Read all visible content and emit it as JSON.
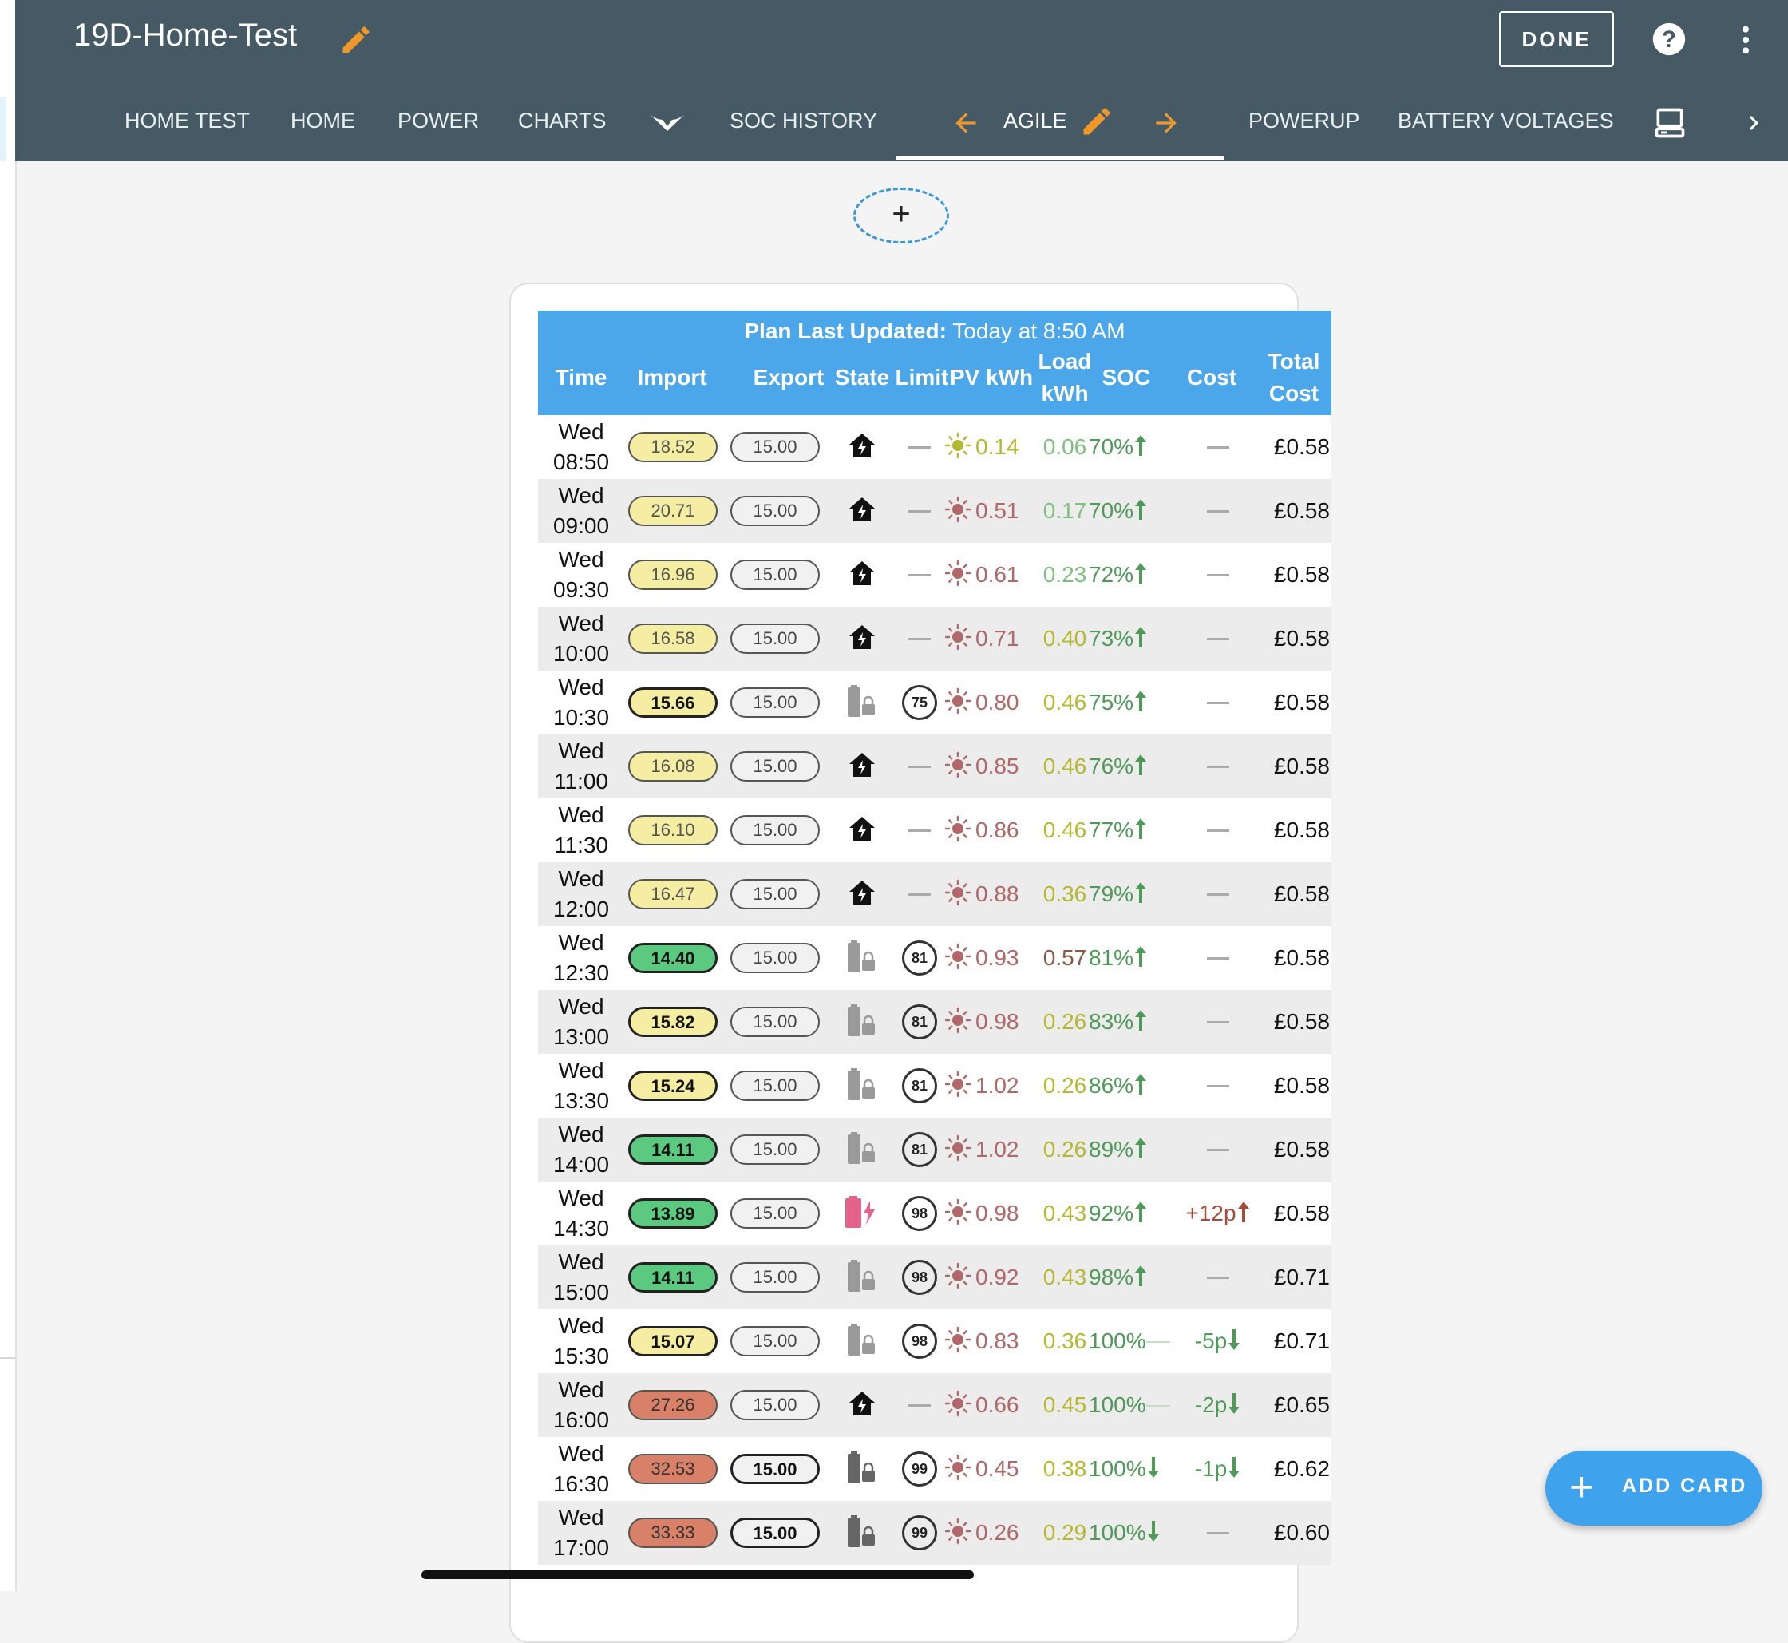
{
  "header": {
    "title": "19D-Home-Test",
    "done_label": "DONE",
    "tabs": [
      {
        "label": "HOME TEST"
      },
      {
        "label": "HOME"
      },
      {
        "label": "POWER"
      },
      {
        "label": "CHARTS"
      },
      {
        "icon": "wings-icon"
      },
      {
        "label": "SOC HISTORY"
      },
      {
        "label": "AGILE",
        "active": true
      },
      {
        "label": "POWERUP"
      },
      {
        "label": "BATTERY VOLTAGES"
      },
      {
        "icon": "computer-icon"
      }
    ]
  },
  "add_view_label": "+",
  "plan": {
    "updated_label": "Plan Last Updated:",
    "updated_value": "Today at 8:50 AM",
    "columns": {
      "time": "Time",
      "import": "Import",
      "export": "Export",
      "state": "State",
      "limit": "Limit",
      "pv": "PV kWh",
      "load_1": "Load",
      "load_2": "kWh",
      "soc": "SOC",
      "cost": "Cost",
      "total_1": "Total",
      "total_2": "Cost"
    },
    "rows": [
      {
        "day": "Wed",
        "time": "08:50",
        "import": "18.52",
        "import_style": "yellow",
        "export": "15.00",
        "export_bold": false,
        "state": "home",
        "limit": "",
        "pv": "0.14",
        "pv_color": "#b5b832",
        "sun_color": "#b5b832",
        "load": "0.06",
        "load_color": "#7fbf7f",
        "soc": "70%",
        "soc_trend": "up",
        "cost": "",
        "cost_trend": "",
        "total": "£0.58"
      },
      {
        "day": "Wed",
        "time": "09:00",
        "import": "20.71",
        "import_style": "yellow",
        "export": "15.00",
        "export_bold": false,
        "state": "home",
        "limit": "",
        "pv": "0.51",
        "pv_color": "#b06868",
        "sun_color": "#b06868",
        "load": "0.17",
        "load_color": "#7fbf7f",
        "soc": "70%",
        "soc_trend": "up",
        "cost": "",
        "cost_trend": "",
        "total": "£0.58"
      },
      {
        "day": "Wed",
        "time": "09:30",
        "import": "16.96",
        "import_style": "yellow",
        "export": "15.00",
        "export_bold": false,
        "state": "home",
        "limit": "",
        "pv": "0.61",
        "pv_color": "#b06868",
        "sun_color": "#b06868",
        "load": "0.23",
        "load_color": "#7fbf7f",
        "soc": "72%",
        "soc_trend": "up",
        "cost": "",
        "cost_trend": "",
        "total": "£0.58"
      },
      {
        "day": "Wed",
        "time": "10:00",
        "import": "16.58",
        "import_style": "yellow",
        "export": "15.00",
        "export_bold": false,
        "state": "home",
        "limit": "",
        "pv": "0.71",
        "pv_color": "#b06868",
        "sun_color": "#b06868",
        "load": "0.40",
        "load_color": "#b5b832",
        "soc": "73%",
        "soc_trend": "up",
        "cost": "",
        "cost_trend": "",
        "total": "£0.58"
      },
      {
        "day": "Wed",
        "time": "10:30",
        "import": "15.66",
        "import_style": "yellow-b",
        "export": "15.00",
        "export_bold": false,
        "state": "battery-lock",
        "limit": "75",
        "pv": "0.80",
        "pv_color": "#b06868",
        "sun_color": "#b06868",
        "load": "0.46",
        "load_color": "#b5b832",
        "soc": "75%",
        "soc_trend": "up",
        "cost": "",
        "cost_trend": "",
        "total": "£0.58"
      },
      {
        "day": "Wed",
        "time": "11:00",
        "import": "16.08",
        "import_style": "yellow",
        "export": "15.00",
        "export_bold": false,
        "state": "home",
        "limit": "",
        "pv": "0.85",
        "pv_color": "#b06868",
        "sun_color": "#b06868",
        "load": "0.46",
        "load_color": "#b5b832",
        "soc": "76%",
        "soc_trend": "up",
        "cost": "",
        "cost_trend": "",
        "total": "£0.58"
      },
      {
        "day": "Wed",
        "time": "11:30",
        "import": "16.10",
        "import_style": "yellow",
        "export": "15.00",
        "export_bold": false,
        "state": "home",
        "limit": "",
        "pv": "0.86",
        "pv_color": "#b06868",
        "sun_color": "#b06868",
        "load": "0.46",
        "load_color": "#b5b832",
        "soc": "77%",
        "soc_trend": "up",
        "cost": "",
        "cost_trend": "",
        "total": "£0.58"
      },
      {
        "day": "Wed",
        "time": "12:00",
        "import": "16.47",
        "import_style": "yellow",
        "export": "15.00",
        "export_bold": false,
        "state": "home",
        "limit": "",
        "pv": "0.88",
        "pv_color": "#b06868",
        "sun_color": "#b06868",
        "load": "0.36",
        "load_color": "#b5b832",
        "soc": "79%",
        "soc_trend": "up",
        "cost": "",
        "cost_trend": "",
        "total": "£0.58"
      },
      {
        "day": "Wed",
        "time": "12:30",
        "import": "14.40",
        "import_style": "green",
        "export": "15.00",
        "export_bold": false,
        "state": "battery-lock",
        "limit": "81",
        "pv": "0.93",
        "pv_color": "#b06868",
        "sun_color": "#b06868",
        "load": "0.57",
        "load_color": "#8a5a44",
        "soc": "81%",
        "soc_trend": "up",
        "cost": "",
        "cost_trend": "",
        "total": "£0.58"
      },
      {
        "day": "Wed",
        "time": "13:00",
        "import": "15.82",
        "import_style": "yellow-b",
        "export": "15.00",
        "export_bold": false,
        "state": "battery-lock",
        "limit": "81",
        "pv": "0.98",
        "pv_color": "#b06868",
        "sun_color": "#b06868",
        "load": "0.26",
        "load_color": "#b5b832",
        "soc": "83%",
        "soc_trend": "up",
        "cost": "",
        "cost_trend": "",
        "total": "£0.58"
      },
      {
        "day": "Wed",
        "time": "13:30",
        "import": "15.24",
        "import_style": "yellow-b",
        "export": "15.00",
        "export_bold": false,
        "state": "battery-lock",
        "limit": "81",
        "pv": "1.02",
        "pv_color": "#b06868",
        "sun_color": "#b06868",
        "load": "0.26",
        "load_color": "#b5b832",
        "soc": "86%",
        "soc_trend": "up",
        "cost": "",
        "cost_trend": "",
        "total": "£0.58"
      },
      {
        "day": "Wed",
        "time": "14:00",
        "import": "14.11",
        "import_style": "green",
        "export": "15.00",
        "export_bold": false,
        "state": "battery-lock",
        "limit": "81",
        "pv": "1.02",
        "pv_color": "#b06868",
        "sun_color": "#b06868",
        "load": "0.26",
        "load_color": "#b5b832",
        "soc": "89%",
        "soc_trend": "up",
        "cost": "",
        "cost_trend": "",
        "total": "£0.58"
      },
      {
        "day": "Wed",
        "time": "14:30",
        "import": "13.89",
        "import_style": "green",
        "export": "15.00",
        "export_bold": false,
        "state": "battery-charge",
        "limit": "98",
        "pv": "0.98",
        "pv_color": "#b06868",
        "sun_color": "#b06868",
        "load": "0.43",
        "load_color": "#b5b832",
        "soc": "92%",
        "soc_trend": "up",
        "cost": "+12p",
        "cost_trend": "up",
        "total": "£0.58"
      },
      {
        "day": "Wed",
        "time": "15:00",
        "import": "14.11",
        "import_style": "green",
        "export": "15.00",
        "export_bold": false,
        "state": "battery-lock",
        "limit": "98",
        "pv": "0.92",
        "pv_color": "#b06868",
        "sun_color": "#b06868",
        "load": "0.43",
        "load_color": "#b5b832",
        "soc": "98%",
        "soc_trend": "up",
        "cost": "",
        "cost_trend": "",
        "total": "£0.71"
      },
      {
        "day": "Wed",
        "time": "15:30",
        "import": "15.07",
        "import_style": "yellow-b",
        "export": "15.00",
        "export_bold": false,
        "state": "battery-lock",
        "limit": "98",
        "pv": "0.83",
        "pv_color": "#b06868",
        "sun_color": "#b06868",
        "load": "0.36",
        "load_color": "#b5b832",
        "soc": "100%",
        "soc_trend": "flat",
        "cost": "-5p",
        "cost_trend": "down",
        "total": "£0.71"
      },
      {
        "day": "Wed",
        "time": "16:00",
        "import": "27.26",
        "import_style": "red",
        "export": "15.00",
        "export_bold": false,
        "state": "home",
        "limit": "",
        "pv": "0.66",
        "pv_color": "#b06868",
        "sun_color": "#b06868",
        "load": "0.45",
        "load_color": "#b5b832",
        "soc": "100%",
        "soc_trend": "flat",
        "cost": "-2p",
        "cost_trend": "down",
        "total": "£0.65"
      },
      {
        "day": "Wed",
        "time": "16:30",
        "import": "32.53",
        "import_style": "red",
        "export": "15.00",
        "export_bold": true,
        "state": "battery-lock-dark",
        "limit": "99",
        "pv": "0.45",
        "pv_color": "#b06868",
        "sun_color": "#b06868",
        "load": "0.38",
        "load_color": "#b5b832",
        "soc": "100%",
        "soc_trend": "down",
        "cost": "-1p",
        "cost_trend": "down",
        "total": "£0.62"
      },
      {
        "day": "Wed",
        "time": "17:00",
        "import": "33.33",
        "import_style": "red",
        "export": "15.00",
        "export_bold": true,
        "state": "battery-lock-dark",
        "limit": "99",
        "pv": "0.26",
        "pv_color": "#b06868",
        "sun_color": "#b06868",
        "load": "0.29",
        "load_color": "#b5b832",
        "soc": "100%",
        "soc_trend": "down",
        "cost": "",
        "cost_trend": "",
        "total": "£0.60"
      }
    ]
  },
  "add_card_label": "ADD CARD",
  "colors": {
    "header_bg": "#455a64",
    "plan_header_bg": "#4ba7ea",
    "accent_orange": "#f0972b",
    "fab_bg": "#3ea3ec"
  }
}
